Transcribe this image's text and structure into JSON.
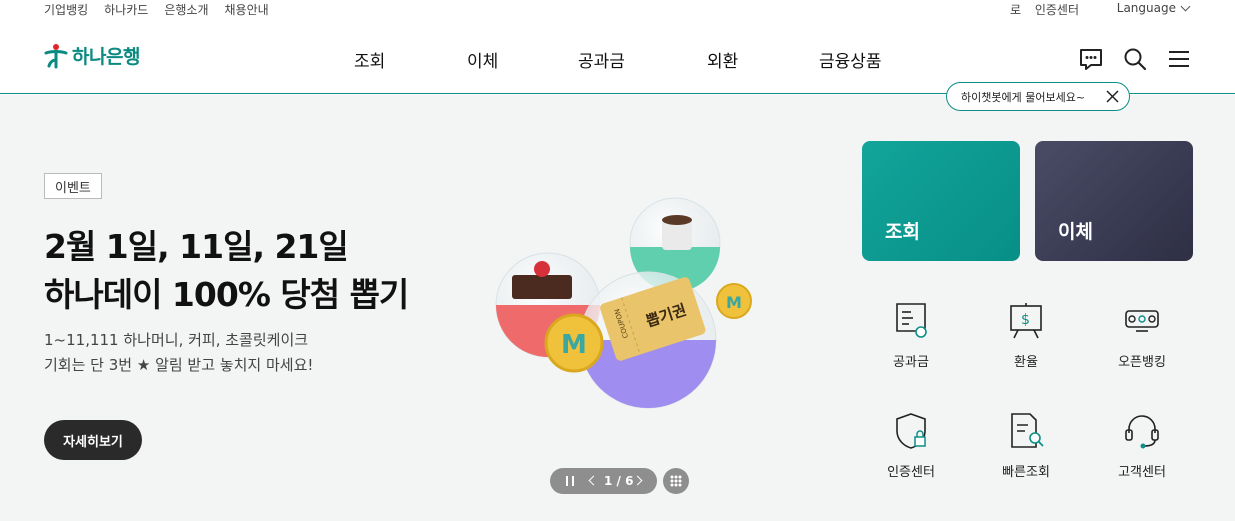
{
  "utility": {
    "left_links": [
      "기업뱅킹",
      "하나카드",
      "은행소개",
      "채용안내"
    ],
    "login": "로그인",
    "cert": "인증센터",
    "language": "Language"
  },
  "header": {
    "logo_text": "하나은행",
    "gnb": [
      "조회",
      "이체",
      "공과금",
      "외환",
      "금융상품"
    ],
    "icons": [
      "chat-icon",
      "search-icon",
      "menu-icon"
    ],
    "tooltip": "하이챗봇에게 물어보세요~"
  },
  "hero": {
    "badge": "이벤트",
    "title_line1": "2월 1일, 11일, 21일",
    "title_line2": "하나데이 100% 당첨 뽑기",
    "desc_line1": "1~11,111 하나머니, 커피, 초콜릿케이크",
    "desc_line2": "기회는 단 3번 ★ 알림 받고 놓치지 마세요!",
    "detail_button": "자세히보기",
    "coupon_text": "뽑기권",
    "coupon_small": "COUPON",
    "coin_letter": "M",
    "pager": "1 / 6"
  },
  "quick": {
    "cards": [
      "조회",
      "이체"
    ],
    "items": [
      "공과금",
      "환율",
      "오픈뱅킹",
      "인증센터",
      "빠른조회",
      "고객센터"
    ]
  },
  "colors": {
    "brand": "#0e8f87",
    "card_inquiry": "#0a968d",
    "card_transfer": "#3a3c55",
    "background": "#f3f5f4"
  }
}
